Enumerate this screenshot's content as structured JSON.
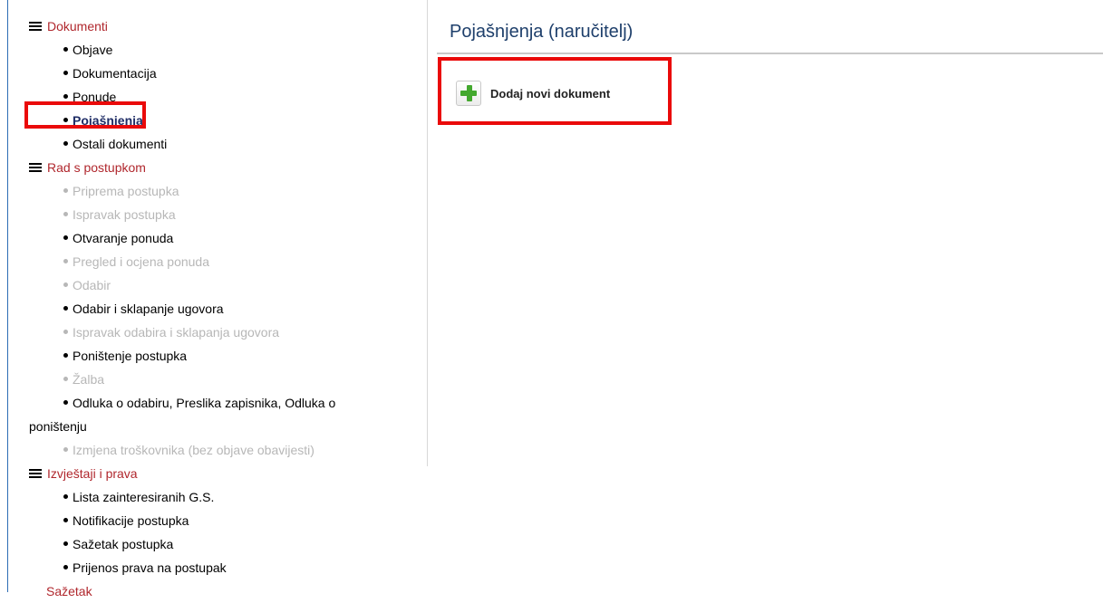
{
  "sidebar": {
    "documents": {
      "heading": "Dokumenti",
      "items": [
        "Objave",
        "Dokumentacija",
        "Ponude",
        "Pojašnjenja",
        "Ostali dokumenti"
      ]
    },
    "procedure": {
      "heading": "Rad s postupkom",
      "items": [
        "Priprema postupka",
        "Ispravak postupka",
        "Otvaranje ponuda",
        "Pregled i ocjena ponuda",
        "Odabir",
        "Odabir i sklapanje ugovora",
        "Ispravak odabira i sklapanja ugovora",
        "Poništenje postupka",
        "Žalba",
        "Odluka o odabiru, Preslika zapisnika, Odluka o",
        "poništenju",
        "Izmjena troškovnika (bez objave obavijesti)"
      ]
    },
    "reports": {
      "heading": "Izvještaji i prava",
      "items": [
        "Lista zainteresiranih G.S.",
        "Notifikacije postupka",
        "Sažetak postupka",
        "Prijenos prava na postupak"
      ]
    },
    "summary_link": "Sažetak"
  },
  "main": {
    "title": "Pojašnjenja (naručitelj)",
    "add_button_label": "Dodaj novi dokument"
  },
  "colors": {
    "section_heading": "#b0272d",
    "title": "#1e3f6b",
    "highlight": "#ea0a0a",
    "plus": "#43a82e"
  }
}
